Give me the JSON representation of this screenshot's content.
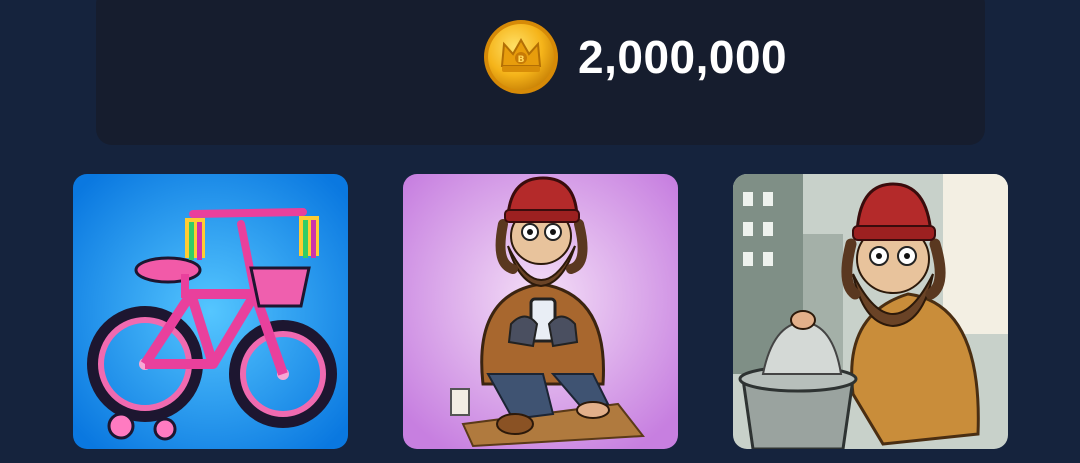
{
  "balance": {
    "icon": "crown-coin-icon",
    "amount": "2,000,000",
    "coin_color": "#f5b41a"
  },
  "shop_items": [
    {
      "name": "pink-bicycle",
      "icon": "bicycle-image",
      "background": "#1e9cf0"
    },
    {
      "name": "homeless-man-with-phone",
      "icon": "homeless-man-phone-image",
      "background": "#c98be0"
    },
    {
      "name": "homeless-man-with-trash-bag",
      "icon": "homeless-man-trash-image",
      "background": "#c6cfc8"
    }
  ]
}
